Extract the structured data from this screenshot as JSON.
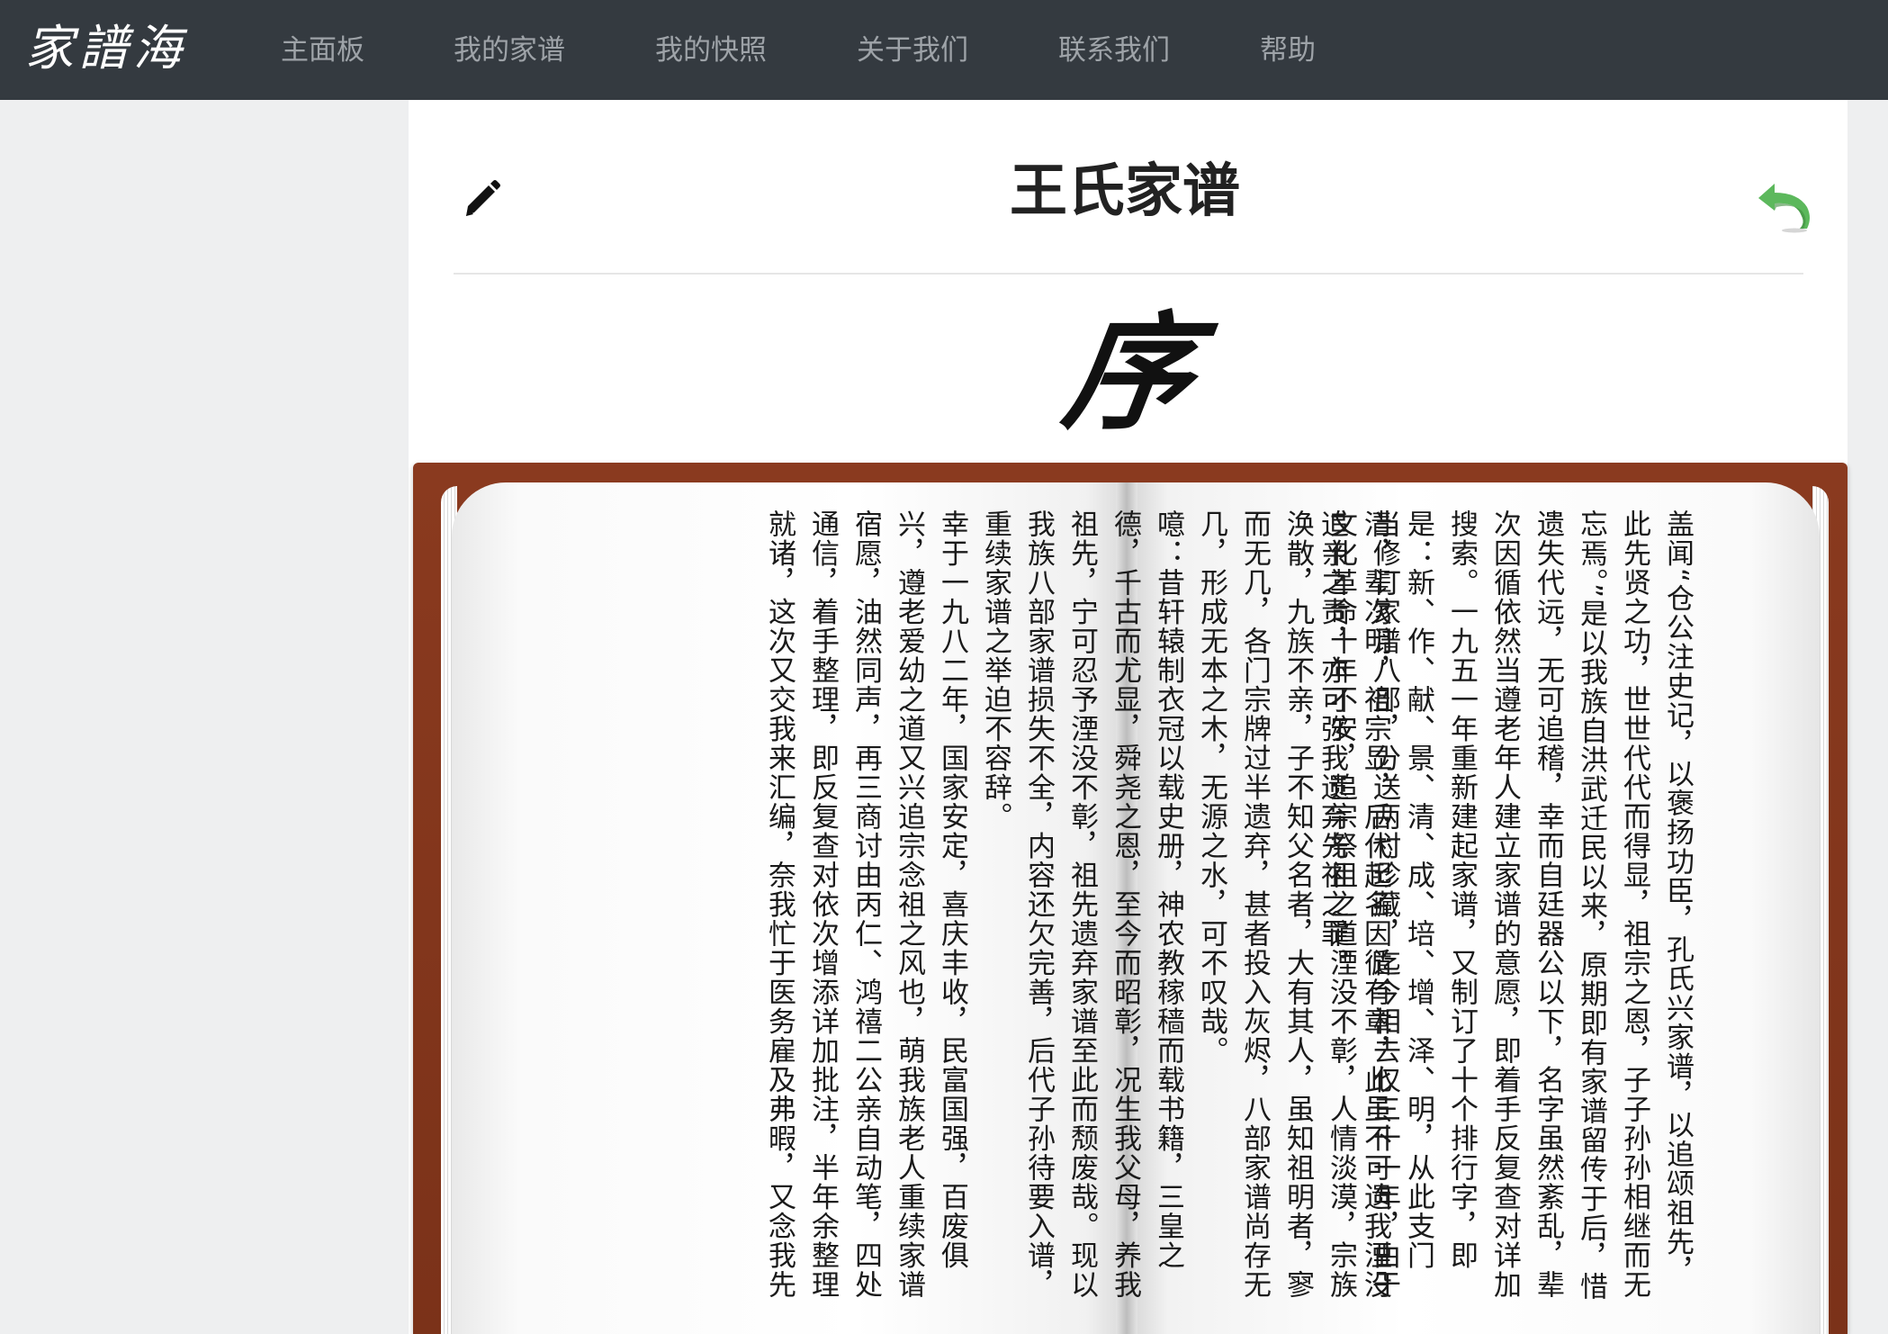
{
  "app": {
    "logo_text": "家譜海",
    "nav": [
      {
        "label": "主面板"
      },
      {
        "label": "我的家谱"
      },
      {
        "label": "我的快照"
      },
      {
        "label": "关于我们"
      },
      {
        "label": "联系我们"
      },
      {
        "label": "帮助"
      }
    ]
  },
  "page": {
    "title": "王氏家谱",
    "section_heading": "序",
    "icons": {
      "edit": "pencil-icon",
      "back": "undo-arrow-icon"
    },
    "colors": {
      "nav_bg": "#343a40",
      "nav_text": "#9ea3a8",
      "back_arrow": "#5cb85c",
      "book_cover": "#7b3219"
    }
  },
  "book": {
    "right_page_text": "盖闻“仓公注史记，以褒扬功臣，孔氏兴家谱，以追颂祖先，此先贤之功，世世代代而得显，祖宗之恩，子子孙孙相继而无忘焉。”是以我族自洪武迁民以来，原期即有家谱留传于后，惜遗失代远，无可追稽，幸而自廷器公以下，名字虽然紊乱，辈次因循依然当遵老年人建立家谱的意愿，即着手反复查对详加搜索。一九五一年重新建起家谱，又制订了十个排行字，即是：新、作、献、景、清、成、培、增、泽、明，从此支门清，辈次明，祖宗显，后代起名因循有章，此虽不可遗我湮没追亲之责，亦可弥我遗弃先祖之罪。",
    "left_page_text": "当修订家谱八部，分送两村珍藏，迄今相去仅三十一年，由于文化革命十年不安，追宗祭祖之道湮没不彰，人情淡漠，宗族涣散，九族不亲，子不知父名者，大有其人，虽知祖明者，寥而无几，各门宗牌过半遗弃，甚者投入灰烬，八部家谱尚存无几，形成无本之木，无源之水，可不叹哉。\n噫：昔轩辕制衣冠以载史册，神农教稼穑而载书籍，三皇之德，千古而尤显，舜尧之恩，至今而昭彰，况生我父母，养我祖先，宁可忍予湮没不彰，祖先遗弃家谱至此而颓废哉。现以我族八部家谱损失不全，内容还欠完善，后代子孙待要入谱，重续家谱之举迫不容辞。\n幸于一九八二年，国家安定，喜庆丰收，民富国强，百废俱兴，遵老爱幼之道又兴追宗念祖之风也，萌我族老人重续家谱宿愿，油然同声，再三商讨由丙仁、鸿禧二公亲自动笔，四处通信，着手整理，即反复查对依次增添详加批注，半年余整理就诸，这次又交我来汇编，奈我忙于医务雇及弗暇，又念我先"
  }
}
